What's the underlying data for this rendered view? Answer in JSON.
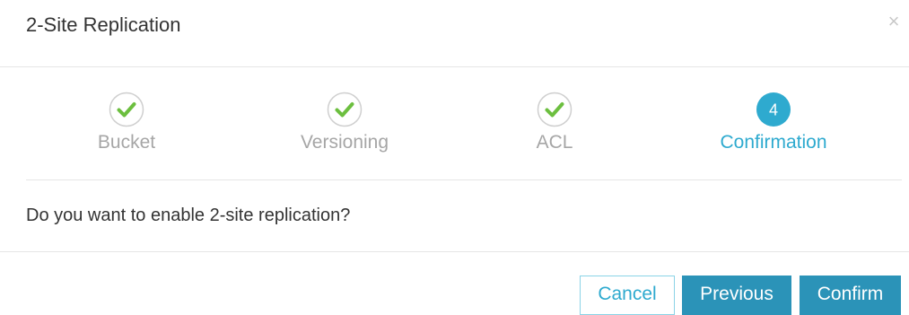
{
  "dialog": {
    "title": "2-Site Replication",
    "close_symbol": "×"
  },
  "steps": [
    {
      "label": "Bucket",
      "state": "done",
      "icon": "checkmark-icon"
    },
    {
      "label": "Versioning",
      "state": "done",
      "icon": "checkmark-icon"
    },
    {
      "label": "ACL",
      "state": "done",
      "icon": "checkmark-icon"
    },
    {
      "label": "Confirmation",
      "state": "active",
      "number": "4"
    }
  ],
  "body": {
    "question": "Do you want to enable 2-site replication?"
  },
  "buttons": {
    "cancel": "Cancel",
    "previous": "Previous",
    "confirm": "Confirm"
  },
  "colors": {
    "accent": "#2eaacf",
    "button_primary": "#2b93b8",
    "check_green": "#6cbf3f",
    "inactive_text": "#a6a6a6"
  }
}
